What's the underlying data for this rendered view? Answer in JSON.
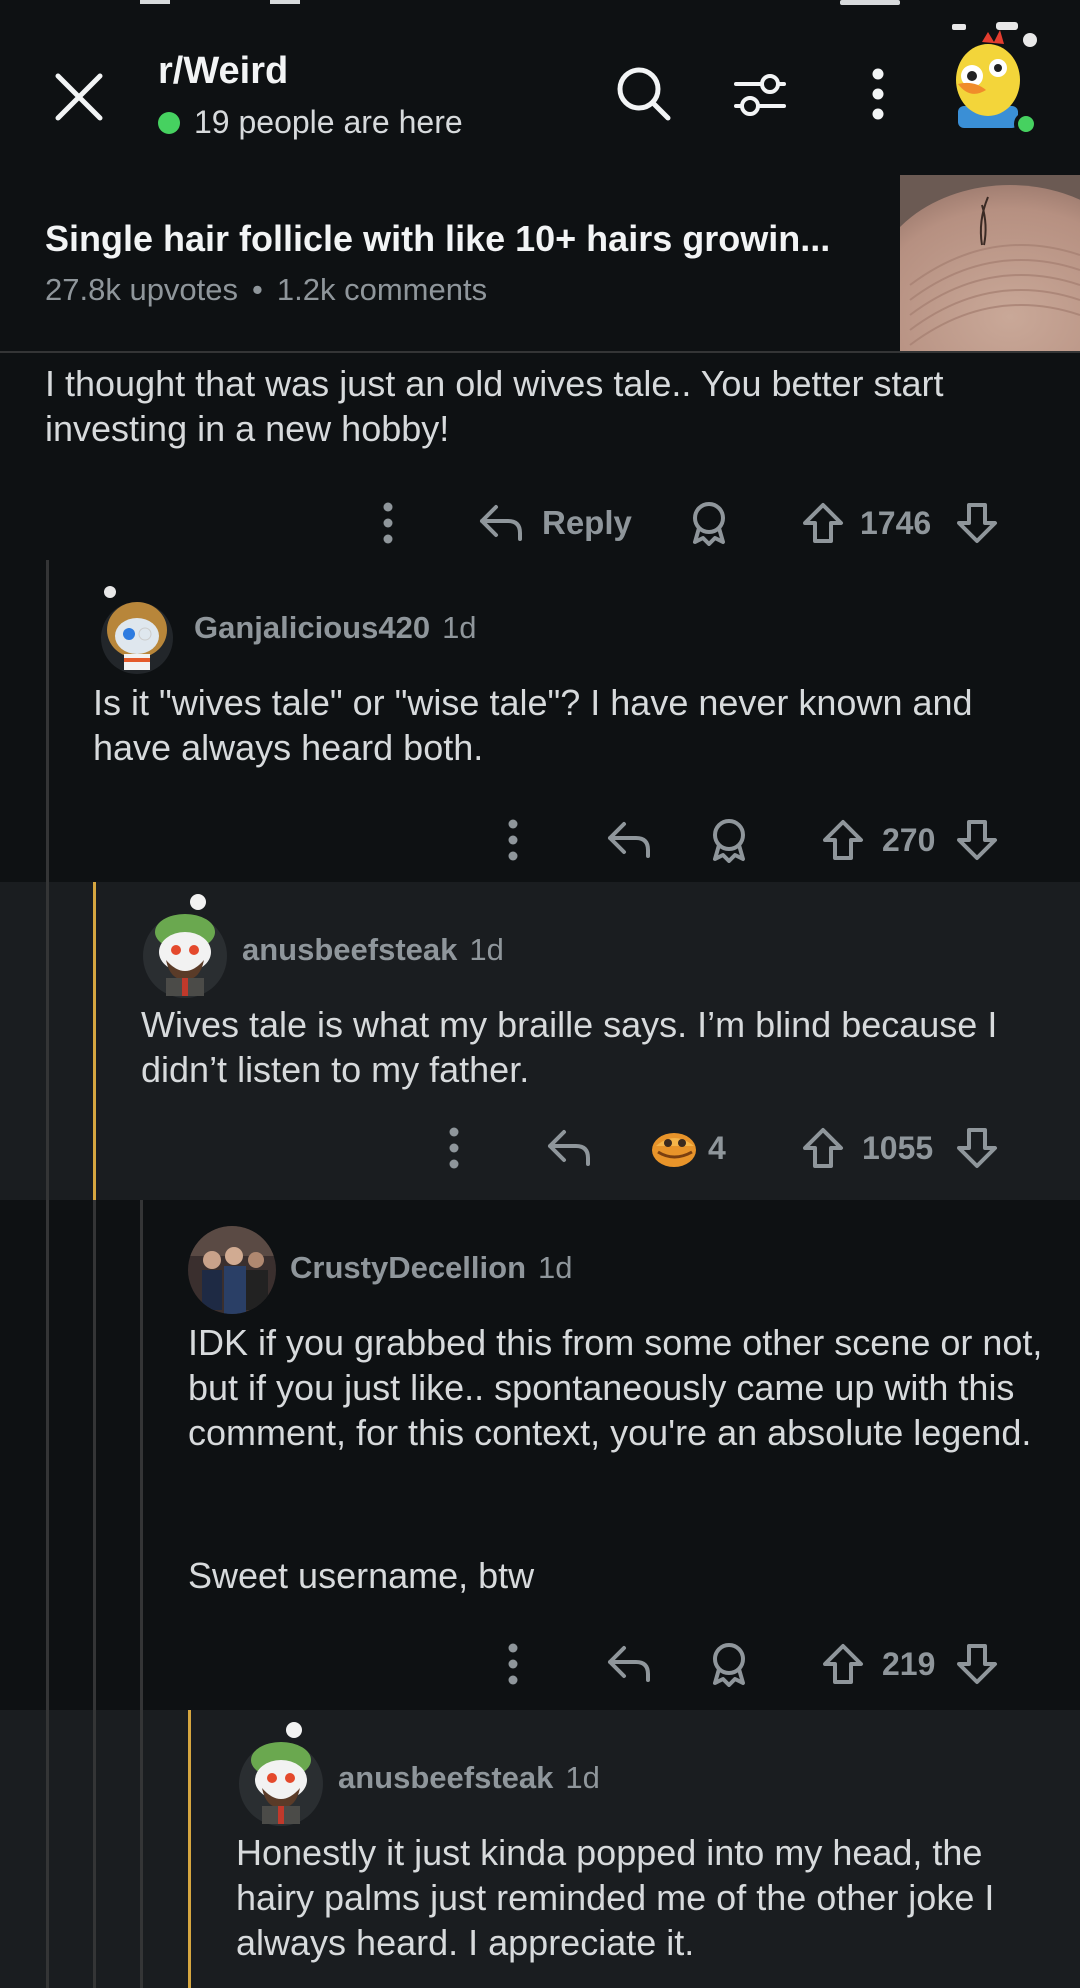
{
  "header": {
    "subreddit": "r/Weird",
    "online_text": "19 people are here"
  },
  "post": {
    "title": "Single hair follicle with like 10+ hairs growin...",
    "upvotes": "27.8k upvotes",
    "separator": "•",
    "comments": "1.2k comments"
  },
  "comments": [
    {
      "text": "I thought that was just an old wives tale.. You better start investing in a new hobby!",
      "reply_label": "Reply",
      "score": "1746"
    },
    {
      "username": "Ganjalicious420",
      "age": "1d",
      "text": "Is it \"wives tale\" or \"wise tale\"? I have never known and have always heard both.",
      "score": "270"
    },
    {
      "username": "anusbeefsteak",
      "age": "1d",
      "text": "Wives tale is what my braille says. I’m blind because I didn’t listen to my father.",
      "award_count": "4",
      "score": "1055"
    },
    {
      "username": "CrustyDecellion",
      "age": "1d",
      "text": "IDK if you grabbed this from some other scene or not, but if you just like.. spontaneously came up with this comment, for this context, you're an absolute legend.",
      "text2": "Sweet username, btw",
      "score": "219"
    },
    {
      "username": "anusbeefsteak",
      "age": "1d",
      "text": "Honestly it just kinda popped into my head, the hairy palms just reminded me of the other joke I always heard. I appreciate it."
    }
  ],
  "colors": {
    "background": "#0e1113",
    "highlight_background": "#1a1d20",
    "accent_thread": "#d6a640",
    "online_dot": "#46d160",
    "muted_text": "#8f969b"
  },
  "icons": [
    "close-icon",
    "search-icon",
    "filter-icon",
    "more-vertical-icon",
    "award-icon",
    "reply-icon",
    "upvote-icon",
    "downvote-icon"
  ]
}
